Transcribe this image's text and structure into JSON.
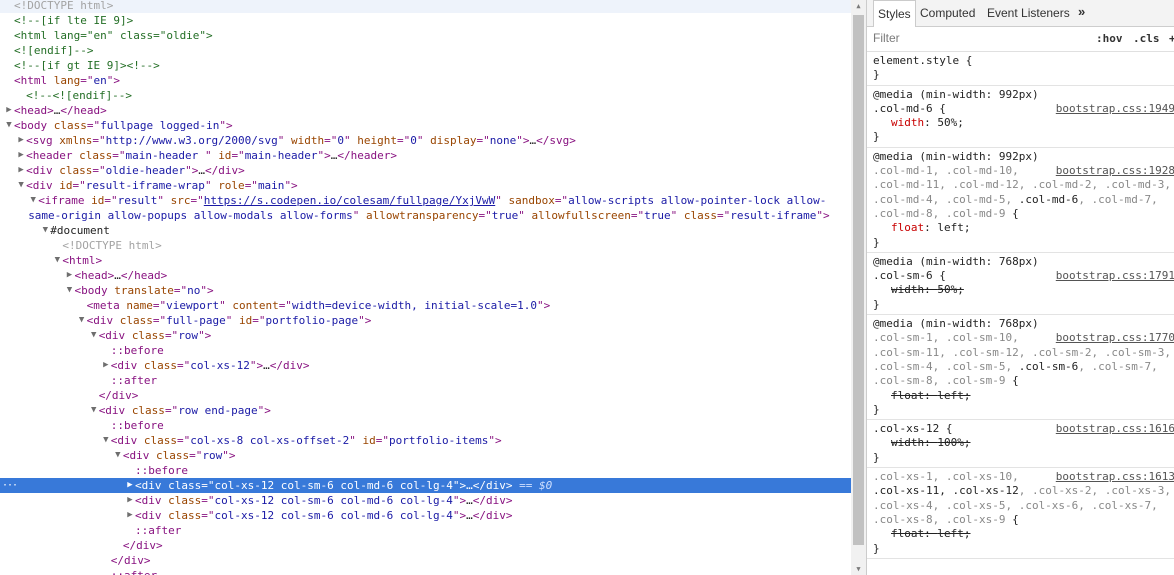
{
  "elements": {
    "lines": [
      {
        "indent": 1,
        "tri": "",
        "segs": [
          [
            "doctype",
            "<!DOCTYPE html>"
          ]
        ],
        "cls": "hover"
      },
      {
        "indent": 1,
        "tri": "",
        "segs": [
          [
            "comment",
            "<!--[if lte IE 9]>"
          ]
        ]
      },
      {
        "indent": 1,
        "tri": "",
        "segs": [
          [
            "comment",
            "<html lang=\"en\" class=\"oldie\">"
          ]
        ]
      },
      {
        "indent": 1,
        "tri": "",
        "segs": [
          [
            "comment",
            "<![endif]-->"
          ]
        ]
      },
      {
        "indent": 1,
        "tri": "",
        "segs": [
          [
            "comment",
            "<!--[if gt IE 9]><!-->"
          ]
        ]
      },
      {
        "indent": 1,
        "tri": "",
        "segs": [
          [
            "tag",
            "<html "
          ],
          [
            "attr",
            "lang"
          ],
          [
            "tag",
            "=\""
          ],
          [
            "val",
            "en"
          ],
          [
            "tag",
            "\">"
          ]
        ]
      },
      {
        "indent": 2,
        "tri": "",
        "segs": [
          [
            "comment",
            "<!--<![endif]-->"
          ]
        ]
      },
      {
        "indent": 1,
        "tri": "▶",
        "segs": [
          [
            "tag",
            "<head>"
          ],
          [
            "ellipsis",
            "…"
          ],
          [
            "tag",
            "</head>"
          ]
        ]
      },
      {
        "indent": 1,
        "tri": "▼",
        "segs": [
          [
            "tag",
            "<body "
          ],
          [
            "attr",
            "class"
          ],
          [
            "tag",
            "=\""
          ],
          [
            "val",
            "fullpage logged-in"
          ],
          [
            "tag",
            "\">"
          ]
        ]
      },
      {
        "indent": 2,
        "tri": "▶",
        "segs": [
          [
            "tag",
            "<svg "
          ],
          [
            "attr",
            "xmlns"
          ],
          [
            "tag",
            "=\""
          ],
          [
            "val",
            "http://www.w3.org/2000/svg"
          ],
          [
            "tag",
            "\" "
          ],
          [
            "attr",
            "width"
          ],
          [
            "tag",
            "=\""
          ],
          [
            "val",
            "0"
          ],
          [
            "tag",
            "\" "
          ],
          [
            "attr",
            "height"
          ],
          [
            "tag",
            "=\""
          ],
          [
            "val",
            "0"
          ],
          [
            "tag",
            "\" "
          ],
          [
            "attr",
            "display"
          ],
          [
            "tag",
            "=\""
          ],
          [
            "val",
            "none"
          ],
          [
            "tag",
            "\">"
          ],
          [
            "ellipsis",
            "…"
          ],
          [
            "tag",
            "</svg>"
          ]
        ]
      },
      {
        "indent": 2,
        "tri": "▶",
        "segs": [
          [
            "tag",
            "<header "
          ],
          [
            "attr",
            "class"
          ],
          [
            "tag",
            "=\""
          ],
          [
            "val",
            "main-header "
          ],
          [
            "tag",
            "\" "
          ],
          [
            "attr",
            "id"
          ],
          [
            "tag",
            "=\""
          ],
          [
            "val",
            "main-header"
          ],
          [
            "tag",
            "\">"
          ],
          [
            "ellipsis",
            "…"
          ],
          [
            "tag",
            "</header>"
          ]
        ]
      },
      {
        "indent": 2,
        "tri": "▶",
        "segs": [
          [
            "tag",
            "<div "
          ],
          [
            "attr",
            "class"
          ],
          [
            "tag",
            "=\""
          ],
          [
            "val",
            "oldie-header"
          ],
          [
            "tag",
            "\">"
          ],
          [
            "ellipsis",
            "…"
          ],
          [
            "tag",
            "</div>"
          ]
        ]
      },
      {
        "indent": 2,
        "tri": "▼",
        "segs": [
          [
            "tag",
            "<div "
          ],
          [
            "attr",
            "id"
          ],
          [
            "tag",
            "=\""
          ],
          [
            "val",
            "result-iframe-wrap"
          ],
          [
            "tag",
            "\" "
          ],
          [
            "attr",
            "role"
          ],
          [
            "tag",
            "=\""
          ],
          [
            "val",
            "main"
          ],
          [
            "tag",
            "\">"
          ]
        ]
      },
      {
        "indent": 3,
        "tri": "▼",
        "wrap": true,
        "segs": [
          [
            "tag",
            "<iframe "
          ],
          [
            "attr",
            "id"
          ],
          [
            "tag",
            "=\""
          ],
          [
            "val",
            "result"
          ],
          [
            "tag",
            "\" "
          ],
          [
            "attr",
            "src"
          ],
          [
            "tag",
            "=\""
          ],
          [
            "link",
            "https://s.codepen.io/colesam/fullpage/YxjVwW"
          ],
          [
            "tag",
            "\" "
          ],
          [
            "attr",
            "sandbox"
          ],
          [
            "tag",
            "=\""
          ],
          [
            "val",
            "allow-scripts allow-pointer-lock allow-same-origin allow-popups allow-modals allow-forms"
          ],
          [
            "tag",
            "\" "
          ],
          [
            "attr",
            "allowtransparency"
          ],
          [
            "tag",
            "=\""
          ],
          [
            "val",
            "true"
          ],
          [
            "tag",
            "\" "
          ],
          [
            "attr",
            "allowfullscreen"
          ],
          [
            "tag",
            "=\""
          ],
          [
            "val",
            "true"
          ],
          [
            "tag",
            "\" "
          ],
          [
            "attr",
            "class"
          ],
          [
            "tag",
            "=\""
          ],
          [
            "val",
            "result-iframe"
          ],
          [
            "tag",
            "\">"
          ]
        ]
      },
      {
        "indent": 4,
        "tri": "▼",
        "segs": [
          [
            "plain",
            "#document"
          ]
        ]
      },
      {
        "indent": 5,
        "tri": "",
        "segs": [
          [
            "doctype",
            "<!DOCTYPE html>"
          ]
        ]
      },
      {
        "indent": 5,
        "tri": "▼",
        "segs": [
          [
            "tag",
            "<html>"
          ]
        ]
      },
      {
        "indent": 6,
        "tri": "▶",
        "segs": [
          [
            "tag",
            "<head>"
          ],
          [
            "ellipsis",
            "…"
          ],
          [
            "tag",
            "</head>"
          ]
        ]
      },
      {
        "indent": 6,
        "tri": "▼",
        "segs": [
          [
            "tag",
            "<body "
          ],
          [
            "attr",
            "translate"
          ],
          [
            "tag",
            "=\""
          ],
          [
            "val",
            "no"
          ],
          [
            "tag",
            "\">"
          ]
        ]
      },
      {
        "indent": 7,
        "tri": "",
        "segs": [
          [
            "tag",
            "<meta "
          ],
          [
            "attr",
            "name"
          ],
          [
            "tag",
            "=\""
          ],
          [
            "val",
            "viewport"
          ],
          [
            "tag",
            "\" "
          ],
          [
            "attr",
            "content"
          ],
          [
            "tag",
            "=\""
          ],
          [
            "val",
            "width=device-width, initial-scale=1.0"
          ],
          [
            "tag",
            "\">"
          ]
        ]
      },
      {
        "indent": 7,
        "tri": "▼",
        "segs": [
          [
            "tag",
            "<div "
          ],
          [
            "attr",
            "class"
          ],
          [
            "tag",
            "=\""
          ],
          [
            "val",
            "full-page"
          ],
          [
            "tag",
            "\" "
          ],
          [
            "attr",
            "id"
          ],
          [
            "tag",
            "=\""
          ],
          [
            "val",
            "portfolio-page"
          ],
          [
            "tag",
            "\">"
          ]
        ]
      },
      {
        "indent": 8,
        "tri": "▼",
        "segs": [
          [
            "tag",
            "<div "
          ],
          [
            "attr",
            "class"
          ],
          [
            "tag",
            "=\""
          ],
          [
            "val",
            "row"
          ],
          [
            "tag",
            "\">"
          ]
        ]
      },
      {
        "indent": 9,
        "tri": "",
        "segs": [
          [
            "pseudo",
            "::before"
          ]
        ]
      },
      {
        "indent": 9,
        "tri": "▶",
        "segs": [
          [
            "tag",
            "<div "
          ],
          [
            "attr",
            "class"
          ],
          [
            "tag",
            "=\""
          ],
          [
            "val",
            "col-xs-12"
          ],
          [
            "tag",
            "\">"
          ],
          [
            "ellipsis",
            "…"
          ],
          [
            "tag",
            "</div>"
          ]
        ]
      },
      {
        "indent": 9,
        "tri": "",
        "segs": [
          [
            "pseudo",
            "::after"
          ]
        ]
      },
      {
        "indent": 8,
        "tri": "",
        "segs": [
          [
            "tag",
            "</div>"
          ]
        ]
      },
      {
        "indent": 8,
        "tri": "▼",
        "segs": [
          [
            "tag",
            "<div "
          ],
          [
            "attr",
            "class"
          ],
          [
            "tag",
            "=\""
          ],
          [
            "val",
            "row end-page"
          ],
          [
            "tag",
            "\">"
          ]
        ]
      },
      {
        "indent": 9,
        "tri": "",
        "segs": [
          [
            "pseudo",
            "::before"
          ]
        ]
      },
      {
        "indent": 9,
        "tri": "▼",
        "segs": [
          [
            "tag",
            "<div "
          ],
          [
            "attr",
            "class"
          ],
          [
            "tag",
            "=\""
          ],
          [
            "val",
            "col-xs-8 col-xs-offset-2"
          ],
          [
            "tag",
            "\" "
          ],
          [
            "attr",
            "id"
          ],
          [
            "tag",
            "=\""
          ],
          [
            "val",
            "portfolio-items"
          ],
          [
            "tag",
            "\">"
          ]
        ]
      },
      {
        "indent": 10,
        "tri": "▼",
        "segs": [
          [
            "tag",
            "<div "
          ],
          [
            "attr",
            "class"
          ],
          [
            "tag",
            "=\""
          ],
          [
            "val",
            "row"
          ],
          [
            "tag",
            "\">"
          ]
        ]
      },
      {
        "indent": 11,
        "tri": "",
        "segs": [
          [
            "pseudo",
            "::before"
          ]
        ]
      },
      {
        "indent": 11,
        "tri": "▶",
        "cls": "selected",
        "segs": [
          [
            "tag",
            "<div "
          ],
          [
            "attr",
            "class"
          ],
          [
            "tag",
            "=\""
          ],
          [
            "val",
            "col-xs-12 col-sm-6 col-md-6 col-lg-4"
          ],
          [
            "tag",
            "\">"
          ],
          [
            "ellipsis",
            "…"
          ],
          [
            "tag",
            "</div>"
          ],
          [
            "sel",
            " == $0"
          ]
        ]
      },
      {
        "indent": 11,
        "tri": "▶",
        "segs": [
          [
            "tag",
            "<div "
          ],
          [
            "attr",
            "class"
          ],
          [
            "tag",
            "=\""
          ],
          [
            "val",
            "col-xs-12 col-sm-6 col-md-6 col-lg-4"
          ],
          [
            "tag",
            "\">"
          ],
          [
            "ellipsis",
            "…"
          ],
          [
            "tag",
            "</div>"
          ]
        ]
      },
      {
        "indent": 11,
        "tri": "▶",
        "segs": [
          [
            "tag",
            "<div "
          ],
          [
            "attr",
            "class"
          ],
          [
            "tag",
            "=\""
          ],
          [
            "val",
            "col-xs-12 col-sm-6 col-md-6 col-lg-4"
          ],
          [
            "tag",
            "\">"
          ],
          [
            "ellipsis",
            "…"
          ],
          [
            "tag",
            "</div>"
          ]
        ]
      },
      {
        "indent": 11,
        "tri": "",
        "segs": [
          [
            "pseudo",
            "::after"
          ]
        ]
      },
      {
        "indent": 10,
        "tri": "",
        "segs": [
          [
            "tag",
            "</div>"
          ]
        ]
      },
      {
        "indent": 9,
        "tri": "",
        "segs": [
          [
            "tag",
            "</div>"
          ]
        ]
      },
      {
        "indent": 9,
        "tri": "",
        "segs": [
          [
            "pseudo",
            "::after"
          ]
        ]
      }
    ],
    "selected_marker": "···"
  },
  "sidebar": {
    "tabs": [
      "Styles",
      "Computed",
      "Event Listeners"
    ],
    "more_tabs": "»",
    "filter_placeholder": "Filter",
    "hov_label": ":hov",
    "cls_label": ".cls",
    "plus_label": "+",
    "rules": [
      {
        "media": "",
        "selector": [
          [
            "match",
            "element.style {"
          ]
        ],
        "source": "",
        "decls": [],
        "close": "}"
      },
      {
        "media": "@media (min-width: 992px)",
        "selector": [
          [
            "match",
            ".col-md-6 {"
          ]
        ],
        "source": "bootstrap.css:1949",
        "decls": [
          {
            "prop": "width",
            "val": "50%;",
            "strike": false
          }
        ],
        "close": "}"
      },
      {
        "media": "@media (min-width: 992px)",
        "selector": [
          [
            "dim",
            ".col-md-1, .col-md-10, .col-md-11, .col-md-12, .col-md-2, .col-md-3, .col-md-4, .col-md-5, "
          ],
          [
            "match",
            ".col-md-6"
          ],
          [
            "dim",
            ", .col-md-7, .col-md-8, .col-md-9 "
          ],
          [
            "match",
            "{"
          ]
        ],
        "source": "bootstrap.css:1928",
        "decls": [
          {
            "prop": "float",
            "val": "left;",
            "strike": false
          }
        ],
        "close": "}"
      },
      {
        "media": "@media (min-width: 768px)",
        "selector": [
          [
            "match",
            ".col-sm-6 {"
          ]
        ],
        "source": "bootstrap.css:1791",
        "decls": [
          {
            "prop": "width",
            "val": "50%;",
            "strike": true
          }
        ],
        "close": "}"
      },
      {
        "media": "@media (min-width: 768px)",
        "selector": [
          [
            "dim",
            ".col-sm-1, .col-sm-10, .col-sm-11, .col-sm-12, .col-sm-2, .col-sm-3, .col-sm-4, .col-sm-5, "
          ],
          [
            "match",
            ".col-sm-6"
          ],
          [
            "dim",
            ", .col-sm-7, .col-sm-8, .col-sm-9 "
          ],
          [
            "match",
            "{"
          ]
        ],
        "source": "bootstrap.css:1770",
        "decls": [
          {
            "prop": "float",
            "val": "left;",
            "strike": true
          }
        ],
        "close": "}"
      },
      {
        "media": "",
        "selector": [
          [
            "match",
            ".col-xs-12 {"
          ]
        ],
        "source": "bootstrap.css:1616",
        "decls": [
          {
            "prop": "width",
            "val": "100%;",
            "strike": true
          }
        ],
        "close": "}"
      },
      {
        "media": "",
        "selector": [
          [
            "dim",
            ".col-xs-1, .col-xs-10, "
          ],
          [
            "match",
            ".col-xs-11, .col-xs-12"
          ],
          [
            "dim",
            ", .col-xs-2, .col-xs-3, .col-xs-4, .col-xs-5, .col-xs-6, .col-xs-7, .col-xs-8, .col-xs-9 "
          ],
          [
            "match",
            "{"
          ]
        ],
        "source": "bootstrap.css:1613",
        "decls": [
          {
            "prop": "float",
            "val": "left;",
            "strike": true
          }
        ],
        "close": "}"
      }
    ]
  }
}
